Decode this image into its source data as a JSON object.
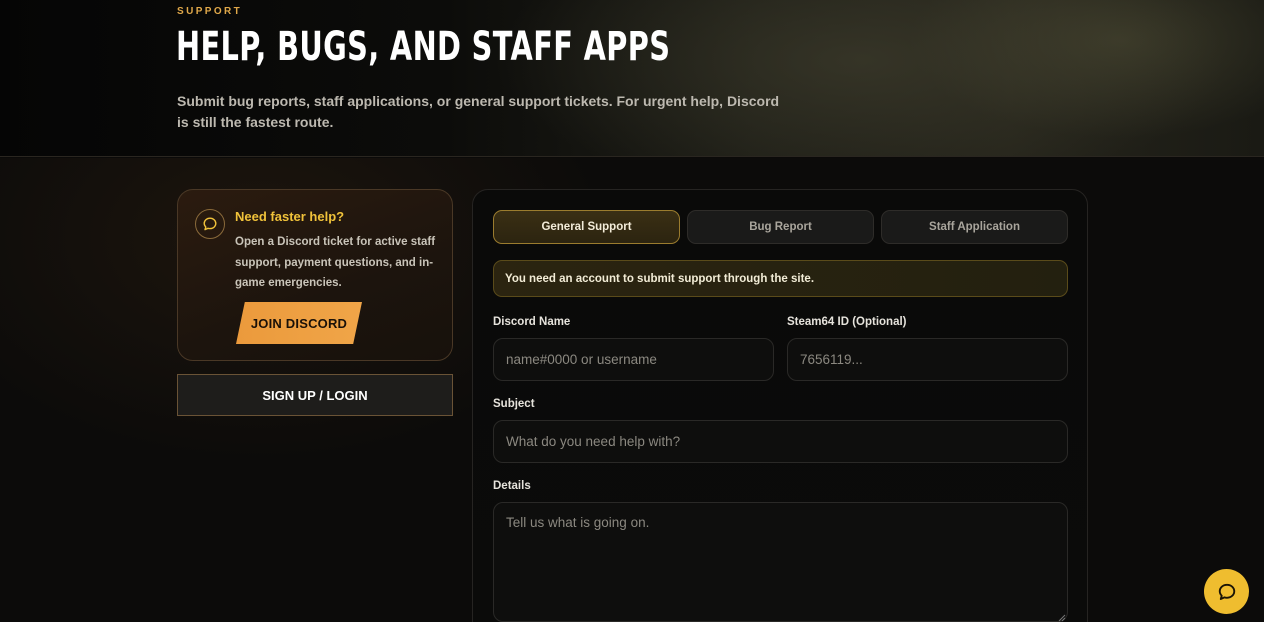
{
  "hero": {
    "eyebrow": "SUPPORT",
    "title": "HELP, BUGS, AND STAFF APPS",
    "description": "Submit bug reports, staff applications, or general support tickets. For urgent help, Discord is still the fastest route."
  },
  "help_card": {
    "icon": "chat-bubble-icon",
    "title": "Need faster help?",
    "text": "Open a Discord ticket for active staff support, payment questions, and in-game emergencies.",
    "button_label": "JOIN DISCORD"
  },
  "login_button_label": "SIGN UP / LOGIN",
  "form": {
    "tabs": [
      {
        "label": "General Support",
        "active": true
      },
      {
        "label": "Bug Report",
        "active": false
      },
      {
        "label": "Staff Application",
        "active": false
      }
    ],
    "notice": "You need an account to submit support through the site.",
    "fields": {
      "discord": {
        "label": "Discord Name",
        "placeholder": "name#0000 or username",
        "value": ""
      },
      "steam": {
        "label": "Steam64 ID (Optional)",
        "placeholder": "7656119...",
        "value": ""
      },
      "subject": {
        "label": "Subject",
        "placeholder": "What do you need help with?",
        "value": ""
      },
      "details": {
        "label": "Details",
        "placeholder": "Tell us what is going on.",
        "value": ""
      }
    }
  },
  "chat_button": {
    "icon": "chat-bubble-icon"
  },
  "colors": {
    "accent_gold": "#f0c23a",
    "accent_orange": "#eb9a3c",
    "background": "#0b0a09"
  }
}
